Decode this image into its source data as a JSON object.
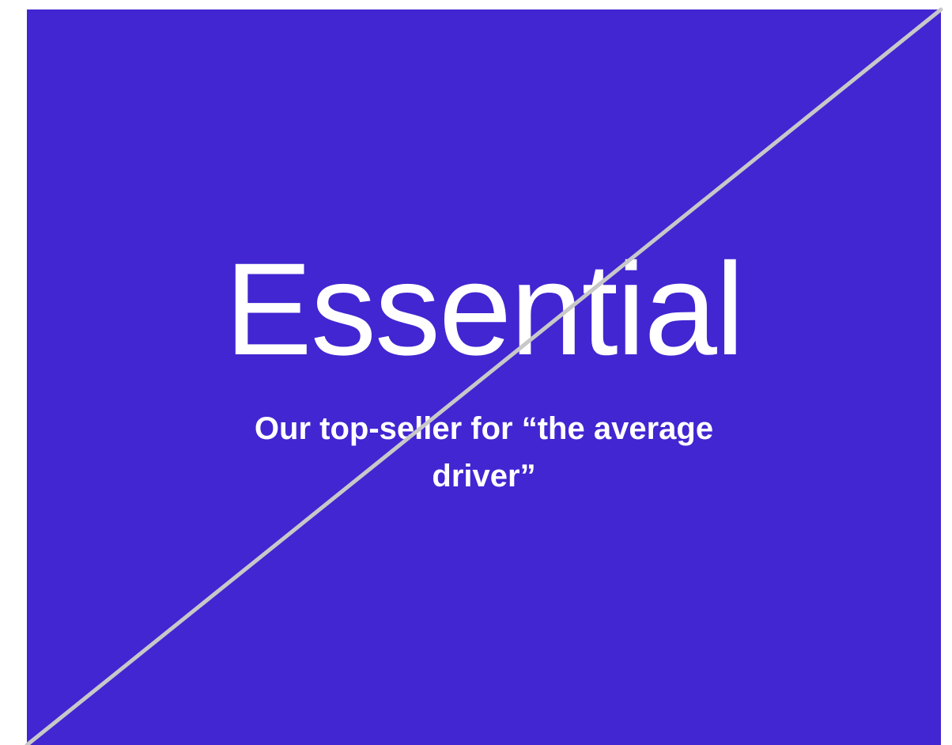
{
  "plan": {
    "title": "Essential",
    "subtitle": "Our top-seller for “the average driver”"
  },
  "colors": {
    "card_background": "#4126d2",
    "text": "#ffffff",
    "strike_line": "#c8c8c8",
    "page_background": "#ffffff"
  }
}
